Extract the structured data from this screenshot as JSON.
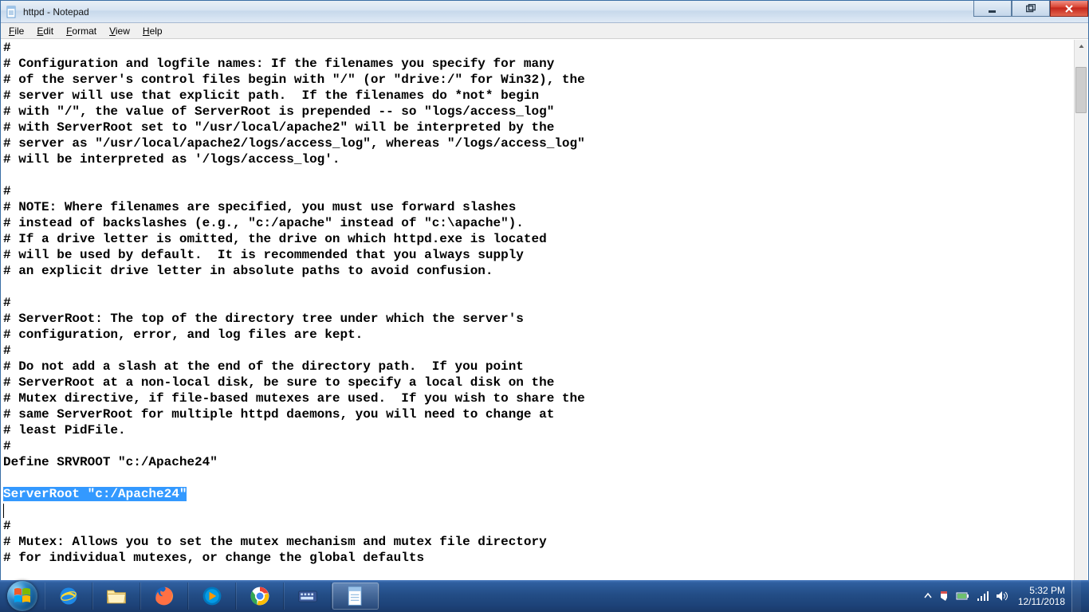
{
  "window": {
    "title": "httpd - Notepad"
  },
  "menus": {
    "file": "File",
    "edit": "Edit",
    "format": "Format",
    "view": "View",
    "help": "Help"
  },
  "editor": {
    "pre_lines": "#\n# Configuration and logfile names: If the filenames you specify for many\n# of the server's control files begin with \"/\" (or \"drive:/\" for Win32), the\n# server will use that explicit path.  If the filenames do *not* begin\n# with \"/\", the value of ServerRoot is prepended -- so \"logs/access_log\"\n# with ServerRoot set to \"/usr/local/apache2\" will be interpreted by the\n# server as \"/usr/local/apache2/logs/access_log\", whereas \"/logs/access_log\"\n# will be interpreted as '/logs/access_log'.\n\n#\n# NOTE: Where filenames are specified, you must use forward slashes\n# instead of backslashes (e.g., \"c:/apache\" instead of \"c:\\apache\").\n# If a drive letter is omitted, the drive on which httpd.exe is located\n# will be used by default.  It is recommended that you always supply\n# an explicit drive letter in absolute paths to avoid confusion.\n\n#\n# ServerRoot: The top of the directory tree under which the server's\n# configuration, error, and log files are kept.\n#\n# Do not add a slash at the end of the directory path.  If you point\n# ServerRoot at a non-local disk, be sure to specify a local disk on the\n# Mutex directive, if file-based mutexes are used.  If you wish to share the\n# same ServerRoot for multiple httpd daemons, you will need to change at\n# least PidFile.\n#\nDefine SRVROOT \"c:/Apache24\"\n",
    "highlighted_line": "ServerRoot \"c:/Apache24\"",
    "post_lines": "\n#\n# Mutex: Allows you to set the mutex mechanism and mutex file directory\n# for individual mutexes, or change the global defaults"
  },
  "tray": {
    "time": "5:32 PM",
    "date": "12/11/2018"
  }
}
